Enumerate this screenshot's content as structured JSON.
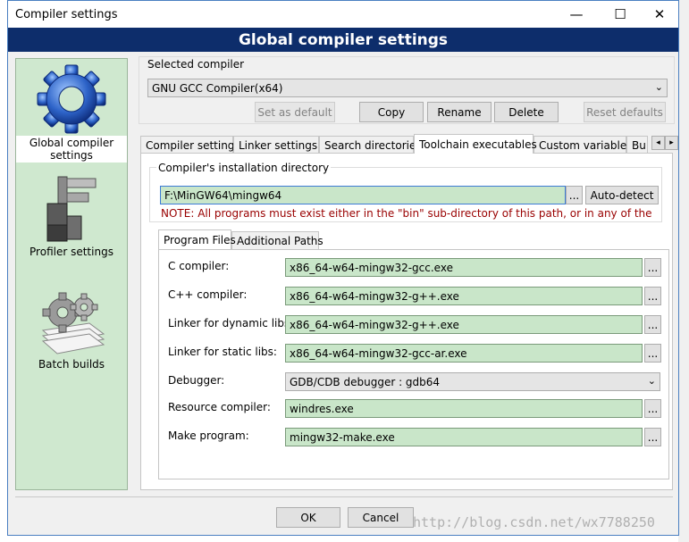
{
  "window": {
    "title": "Compiler settings",
    "minimize_glyph": "—",
    "maximize_glyph": "☐",
    "close_glyph": "✕"
  },
  "banner": {
    "title": "Global compiler settings"
  },
  "nav": {
    "items": [
      {
        "label": "Global compiler settings",
        "icon": "gear-icon",
        "selected": true
      },
      {
        "label": "Profiler settings",
        "icon": "caliper-icon",
        "selected": false
      },
      {
        "label": "Batch builds",
        "icon": "gears-stack-icon",
        "selected": false
      }
    ]
  },
  "compiler_select": {
    "group_label": "Selected compiler",
    "value": "GNU GCC Compiler(x64)",
    "buttons": {
      "set_default": "Set as default",
      "copy": "Copy",
      "rename": "Rename",
      "delete": "Delete",
      "reset_defaults": "Reset defaults"
    }
  },
  "tabs": [
    {
      "label": "Compiler settings",
      "active": false
    },
    {
      "label": "Linker settings",
      "active": false
    },
    {
      "label": "Search directories",
      "active": false
    },
    {
      "label": "Toolchain executables",
      "active": true
    },
    {
      "label": "Custom variables",
      "active": false
    },
    {
      "label": "Bui",
      "active": false
    }
  ],
  "tab_scroll": {
    "left": "◂",
    "right": "▸"
  },
  "install_dir": {
    "group_label": "Compiler's installation directory",
    "value": "F:\\MinGW64\\mingw64",
    "browse": "...",
    "auto_detect": "Auto-detect",
    "note": "NOTE: All programs must exist either in the \"bin\" sub-directory of this path, or in any of the"
  },
  "inner_tabs": [
    {
      "label": "Program Files",
      "active": true
    },
    {
      "label": "Additional Paths",
      "active": false
    }
  ],
  "programs": {
    "browse": "...",
    "rows": [
      {
        "label": "C compiler:",
        "value": "x86_64-w64-mingw32-gcc.exe",
        "type": "field"
      },
      {
        "label": "C++ compiler:",
        "value": "x86_64-w64-mingw32-g++.exe",
        "type": "field"
      },
      {
        "label": "Linker for dynamic libs:",
        "value": "x86_64-w64-mingw32-g++.exe",
        "type": "field"
      },
      {
        "label": "Linker for static libs:",
        "value": "x86_64-w64-mingw32-gcc-ar.exe",
        "type": "field"
      },
      {
        "label": "Debugger:",
        "value": "GDB/CDB debugger : gdb64",
        "type": "combo"
      },
      {
        "label": "Resource compiler:",
        "value": "windres.exe",
        "type": "field"
      },
      {
        "label": "Make program:",
        "value": "mingw32-make.exe",
        "type": "field"
      }
    ]
  },
  "footer": {
    "ok": "OK",
    "cancel": "Cancel"
  },
  "watermark": "http://blog.csdn.net/wx7788250",
  "colors": {
    "banner": "#0d2d6b",
    "field": "#c9e6c9",
    "nav_bg": "#cfe8cf",
    "note": "#990000"
  }
}
